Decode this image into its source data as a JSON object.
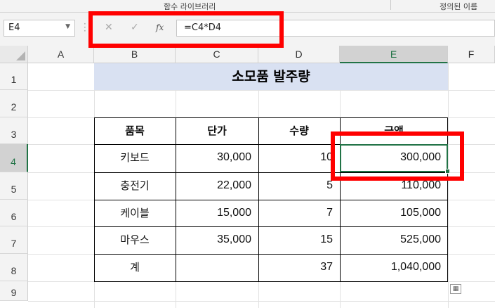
{
  "ribbon": {
    "group_function_library": "함수 라이브러리",
    "group_defined_names": "정의된 이름"
  },
  "formula_bar": {
    "name_box": "E4",
    "cancel_glyph": "✕",
    "enter_glyph": "✓",
    "fx_label": "fx",
    "formula": "=C4*D4"
  },
  "columns": [
    "A",
    "B",
    "C",
    "D",
    "E",
    "F"
  ],
  "selected_column": "E",
  "rows": [
    "1",
    "2",
    "3",
    "4",
    "5",
    "6",
    "7",
    "8",
    "9"
  ],
  "selected_row": "4",
  "sheet": {
    "title": "소모품 발주량",
    "headers": [
      "품목",
      "단가",
      "수량",
      "금액"
    ],
    "data_rows": [
      {
        "item": "키보드",
        "price": "30,000",
        "qty": "10",
        "amount": "300,000"
      },
      {
        "item": "충전기",
        "price": "22,000",
        "qty": "5",
        "amount": "110,000"
      },
      {
        "item": "케이블",
        "price": "15,000",
        "qty": "7",
        "amount": "105,000"
      },
      {
        "item": "마우스",
        "price": "35,000",
        "qty": "15",
        "amount": "525,000"
      }
    ],
    "total": {
      "item": "계",
      "price": "",
      "qty": "37",
      "amount": "1,040,000"
    }
  },
  "selection": {
    "cell": "E4"
  },
  "colors": {
    "title_fill": "#d9e1f2",
    "selection_green": "#217346",
    "highlight_red": "#ff0000"
  },
  "icons": {
    "name_box_dropdown": "chevron-down-icon",
    "quick_analysis": "quick-analysis-icon"
  }
}
